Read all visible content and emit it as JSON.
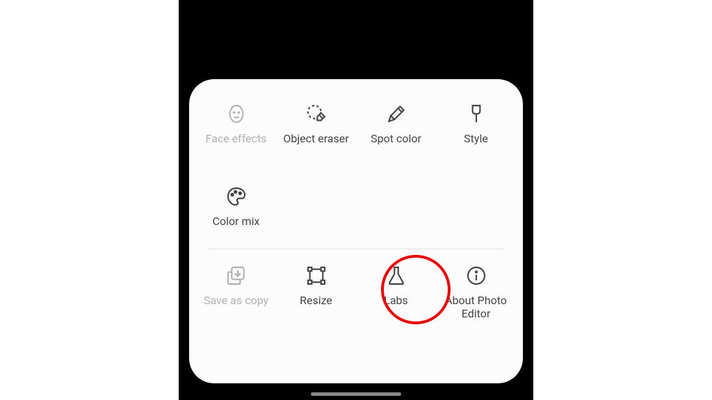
{
  "menu": {
    "faceEffects": {
      "label": "Face effects"
    },
    "objectEraser": {
      "label": "Object eraser"
    },
    "spotColor": {
      "label": "Spot color"
    },
    "style": {
      "label": "Style"
    },
    "colorMix": {
      "label": "Color mix"
    },
    "saveAsCopy": {
      "label": "Save as copy"
    },
    "resize": {
      "label": "Resize"
    },
    "labs": {
      "label": "Labs"
    },
    "about": {
      "label": "About Photo Editor"
    }
  },
  "highlight": {
    "target": "labs",
    "color": "#e60000"
  }
}
